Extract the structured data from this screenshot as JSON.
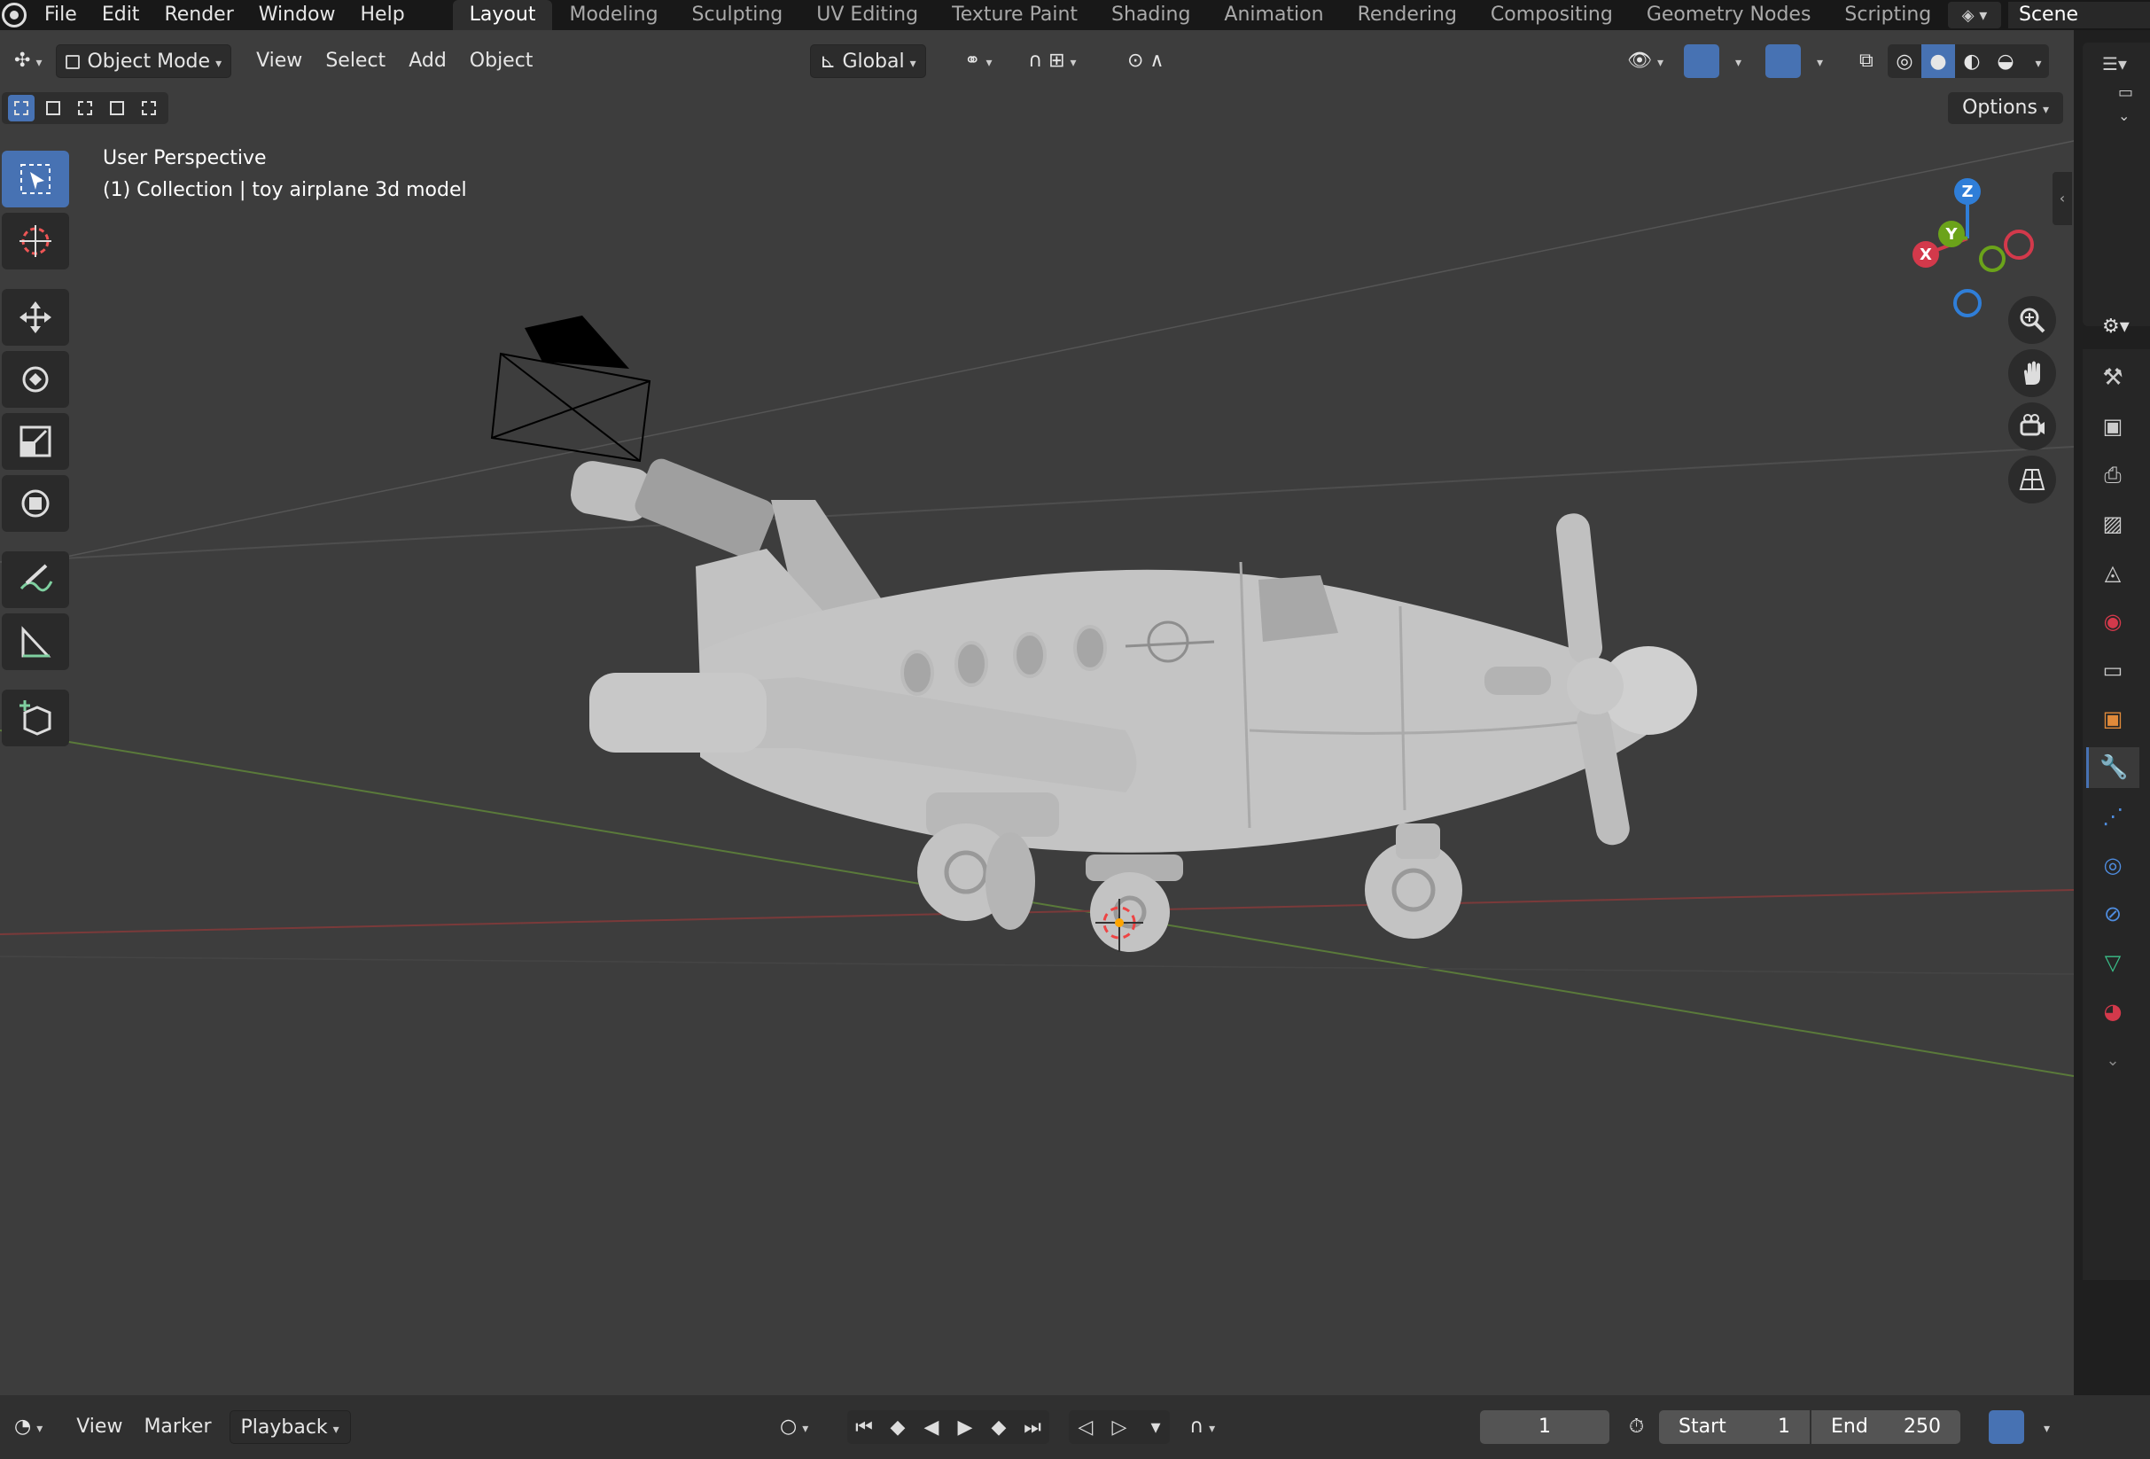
{
  "topbar": {
    "menus": [
      "File",
      "Edit",
      "Render",
      "Window",
      "Help"
    ],
    "workspaces": [
      "Layout",
      "Modeling",
      "Sculpting",
      "UV Editing",
      "Texture Paint",
      "Shading",
      "Animation",
      "Rendering",
      "Compositing",
      "Geometry Nodes",
      "Scripting"
    ],
    "active_workspace": "Layout",
    "add_tab": "+",
    "scene": "Scene"
  },
  "viewport_header": {
    "mode": "Object Mode",
    "menus": [
      "View",
      "Select",
      "Add",
      "Object"
    ],
    "orientation": "Global",
    "options": "Options"
  },
  "viewport": {
    "perspective_label": "User Perspective",
    "collection_label": "(1) Collection | toy airplane 3d model",
    "gizmo_axes": {
      "z": "Z",
      "y": "Y",
      "x": "X"
    }
  },
  "timeline": {
    "menus": [
      "View",
      "Marker"
    ],
    "playback": "Playback",
    "current_frame": "1",
    "start_label": "Start",
    "start_value": "1",
    "end_label": "End",
    "end_value": "250"
  },
  "colors": {
    "accent": "#4772b3",
    "axis_x": "#d3394b",
    "axis_y": "#6ba31a",
    "axis_z": "#2f7ed8",
    "viewport_bg": "#3d3d3d"
  }
}
